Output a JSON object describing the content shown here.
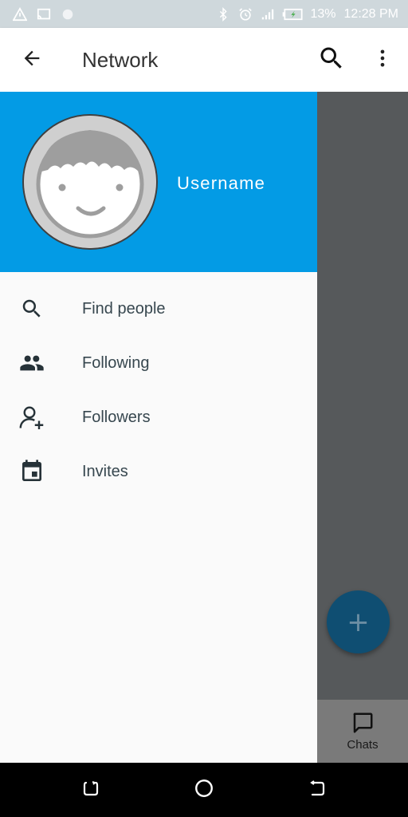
{
  "status_bar": {
    "battery_percent": "13%",
    "time": "12:28 PM",
    "icons": [
      "warning-triangle-icon",
      "cast-icon",
      "circle-icon",
      "bluetooth-icon",
      "alarm-icon",
      "signal-icon",
      "battery-charging-icon"
    ]
  },
  "app_bar": {
    "title": "Network",
    "back_icon": "arrow-back-icon",
    "search_icon": "search-icon",
    "more_icon": "more-vert-icon"
  },
  "drawer": {
    "header_color": "#039be5",
    "username": "Username",
    "menu": [
      {
        "label": "Find people",
        "icon": "search-icon"
      },
      {
        "label": "Following",
        "icon": "people-icon"
      },
      {
        "label": "Followers",
        "icon": "person-add-icon"
      },
      {
        "label": "Invites",
        "icon": "calendar-icon"
      }
    ]
  },
  "background": {
    "fab_icon": "plus-icon",
    "fab_symbol": "+",
    "bottom_tab": {
      "label": "Chats",
      "icon": "chat-bubble-icon"
    }
  },
  "colors": {
    "accent": "#039be5",
    "fab": "#0f4e72",
    "scrim": "#56595b"
  }
}
